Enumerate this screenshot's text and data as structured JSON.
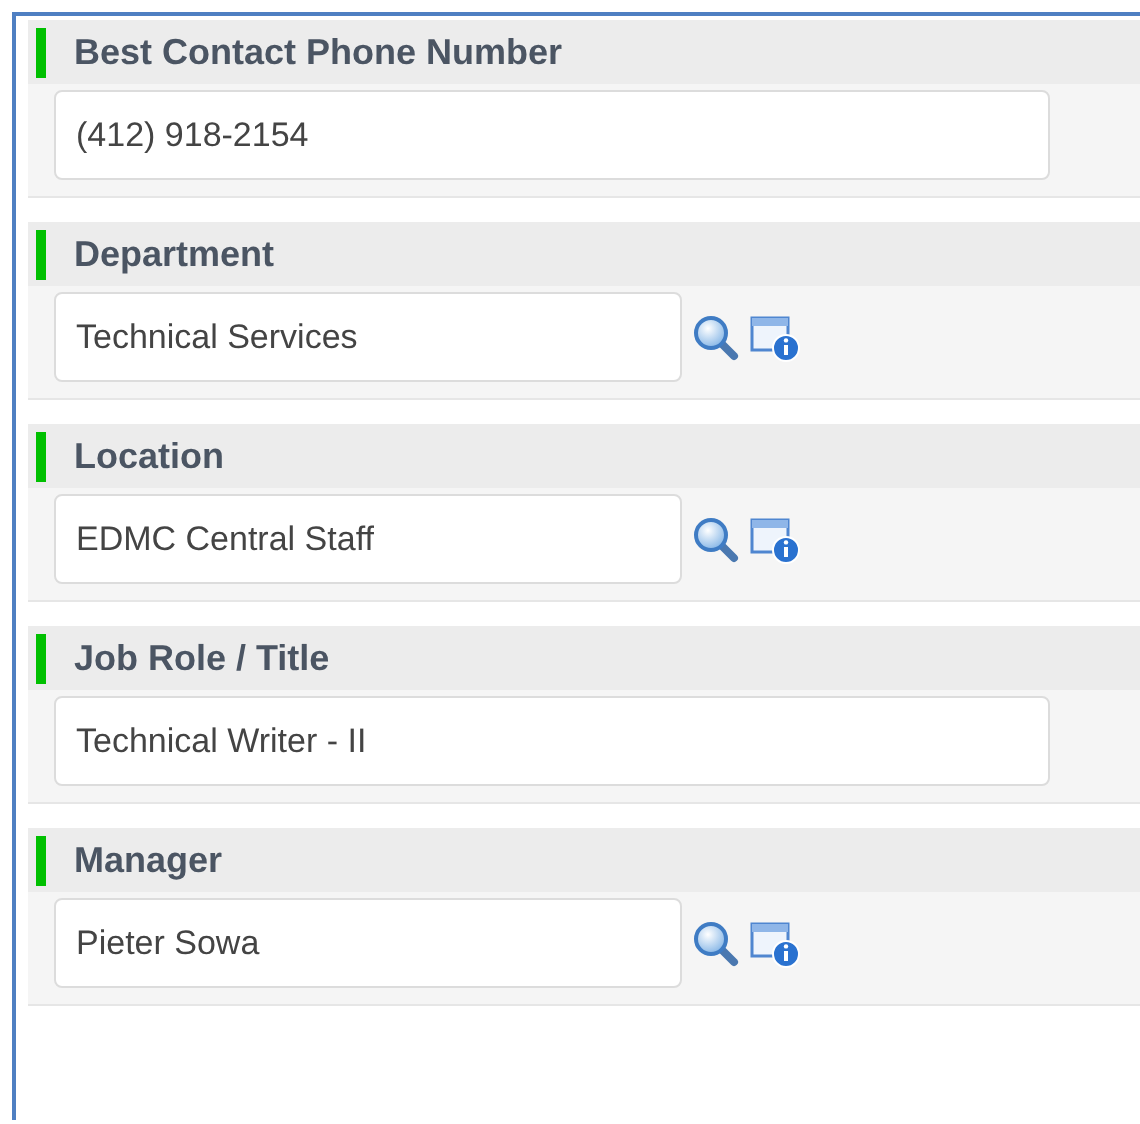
{
  "fields": [
    {
      "label": "Best Contact Phone Number",
      "required": true,
      "kind": "text",
      "value": "(412) 918-2154"
    },
    {
      "label": "Department",
      "required": true,
      "kind": "lookup",
      "value": "Technical Services"
    },
    {
      "label": "Location",
      "required": true,
      "kind": "lookup",
      "value": "EDMC Central Staff"
    },
    {
      "label": "Job Role / Title",
      "required": true,
      "kind": "text",
      "value": "Technical Writer - II"
    },
    {
      "label": "Manager",
      "required": true,
      "kind": "lookup",
      "value": "Pieter Sowa"
    }
  ]
}
